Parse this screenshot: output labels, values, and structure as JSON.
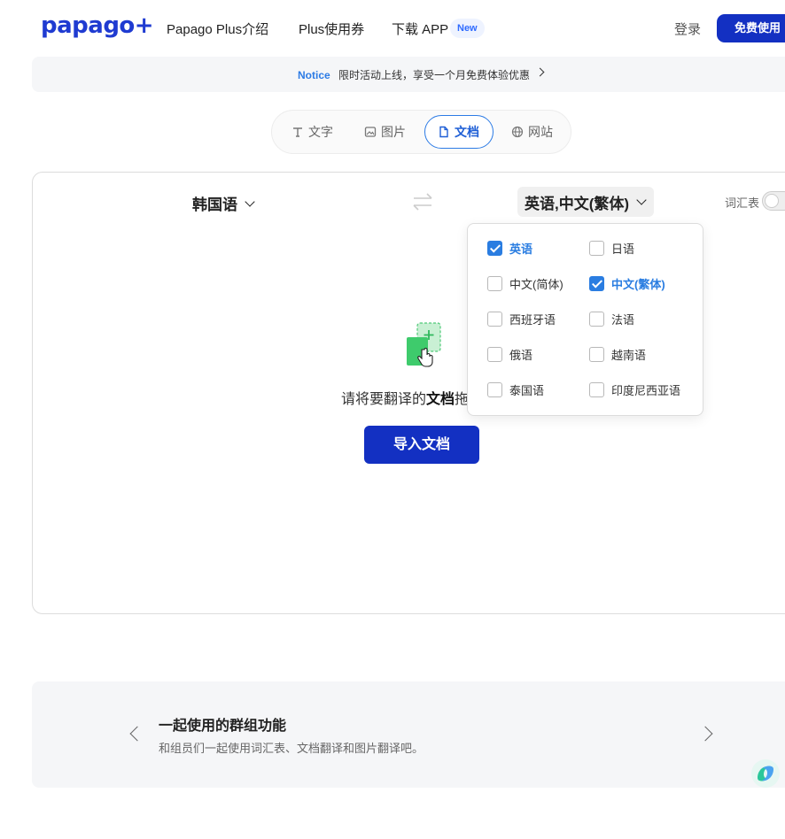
{
  "header": {
    "logo": "papago+",
    "nav": [
      "Papago Plus介绍",
      "Plus使用券",
      "下载 APP"
    ],
    "new_badge": "New",
    "login": "登录",
    "free_button": "免费使用"
  },
  "notice": {
    "label": "Notice",
    "text": "限时活动上线，享受一个月免费体验优惠"
  },
  "tabs": [
    {
      "label": "文字",
      "icon": "text-icon"
    },
    {
      "label": "图片",
      "icon": "image-icon"
    },
    {
      "label": "文档",
      "icon": "document-icon",
      "active": true
    },
    {
      "label": "网站",
      "icon": "globe-icon"
    }
  ],
  "translator": {
    "source_lang": "韩国语",
    "target_lang": "英语,中文(繁体)",
    "vocab_label": "词汇表",
    "drop_prefix": "请将要翻译的",
    "drop_bold": "文档",
    "drop_suffix": "拖",
    "import_button": "导入文档"
  },
  "lang_menu": {
    "options": [
      {
        "label": "英语",
        "checked": true
      },
      {
        "label": "日语",
        "checked": false
      },
      {
        "label": "中文(简体)",
        "checked": false
      },
      {
        "label": "中文(繁体)",
        "checked": true
      },
      {
        "label": "西班牙语",
        "checked": false
      },
      {
        "label": "法语",
        "checked": false
      },
      {
        "label": "俄语",
        "checked": false
      },
      {
        "label": "越南语",
        "checked": false
      },
      {
        "label": "泰国语",
        "checked": false
      },
      {
        "label": "印度尼西亚语",
        "checked": false
      }
    ]
  },
  "carousel": {
    "title": "一起使用的群组功能",
    "subtitle": "和组员们一起使用词汇表、文档翻译和图片翻译吧。"
  },
  "colors": {
    "brand": "#1f3bd1",
    "primary_button": "#1330c2",
    "accent": "#2a7de1"
  }
}
